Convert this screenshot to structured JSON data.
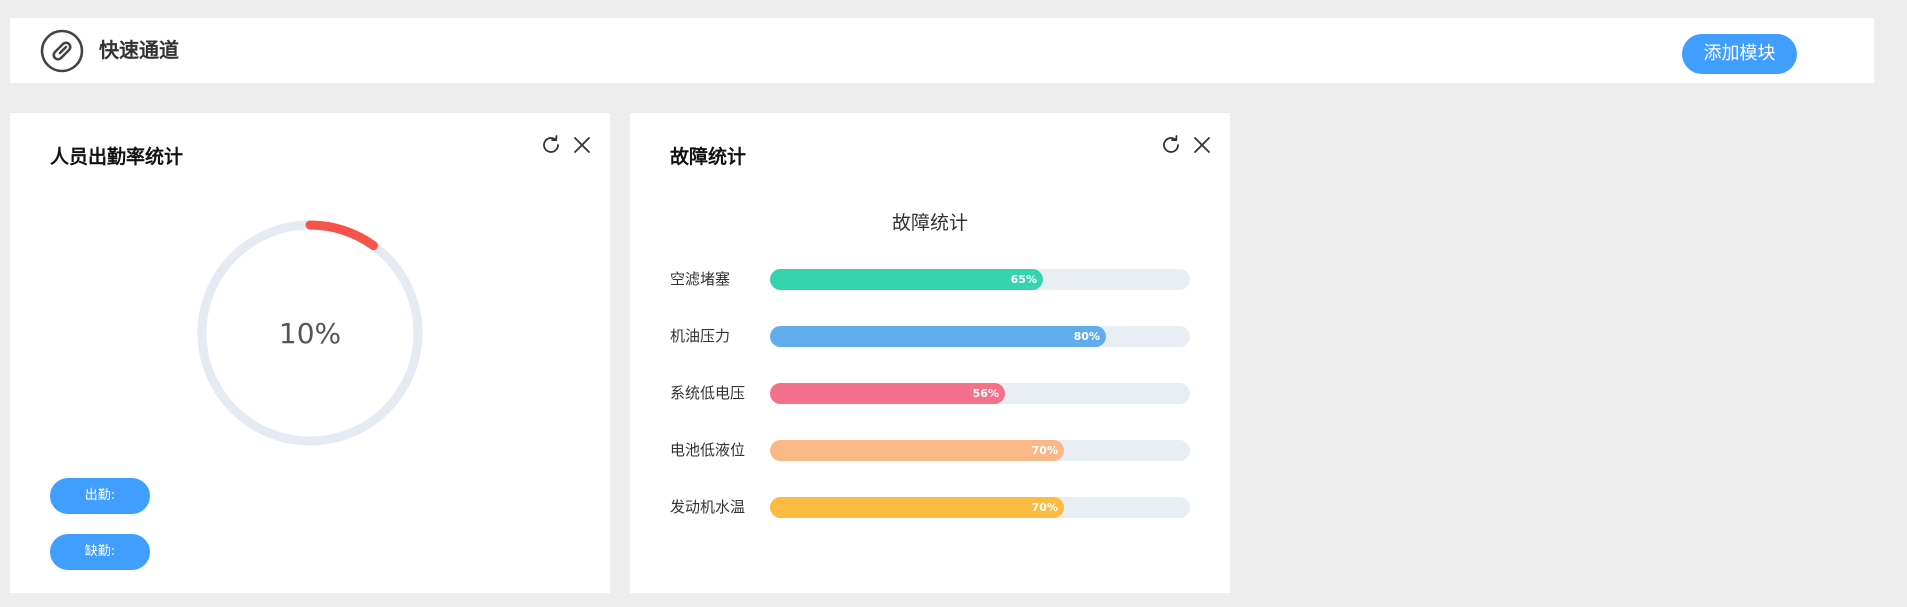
{
  "header": {
    "title": "快速通道",
    "add_module_label": "添加模块"
  },
  "attendance_card": {
    "title": "人员出勤率统计",
    "percent_text": "10%",
    "rate": 0.1,
    "ring_color": "#f8534b",
    "track_color": "#e6eaf2",
    "present_label": "出勤:",
    "absent_label": "缺勤:"
  },
  "fault_card": {
    "title": "故障统计"
  },
  "chart_data": {
    "type": "bar",
    "orientation": "horizontal",
    "title": "故障统计",
    "categories": [
      "空滤堵塞",
      "机油压力",
      "系统低电压",
      "电池低液位",
      "发动机水温"
    ],
    "values": [
      65,
      80,
      56,
      70,
      70
    ],
    "value_labels": [
      "65%",
      "80%",
      "56%",
      "70%",
      "70%"
    ],
    "colors": [
      "#36d4ae",
      "#5fadec",
      "#f5708a",
      "#fab887",
      "#fdbb41"
    ],
    "track_color": "#e9edf4",
    "xlim": [
      0,
      100
    ]
  }
}
